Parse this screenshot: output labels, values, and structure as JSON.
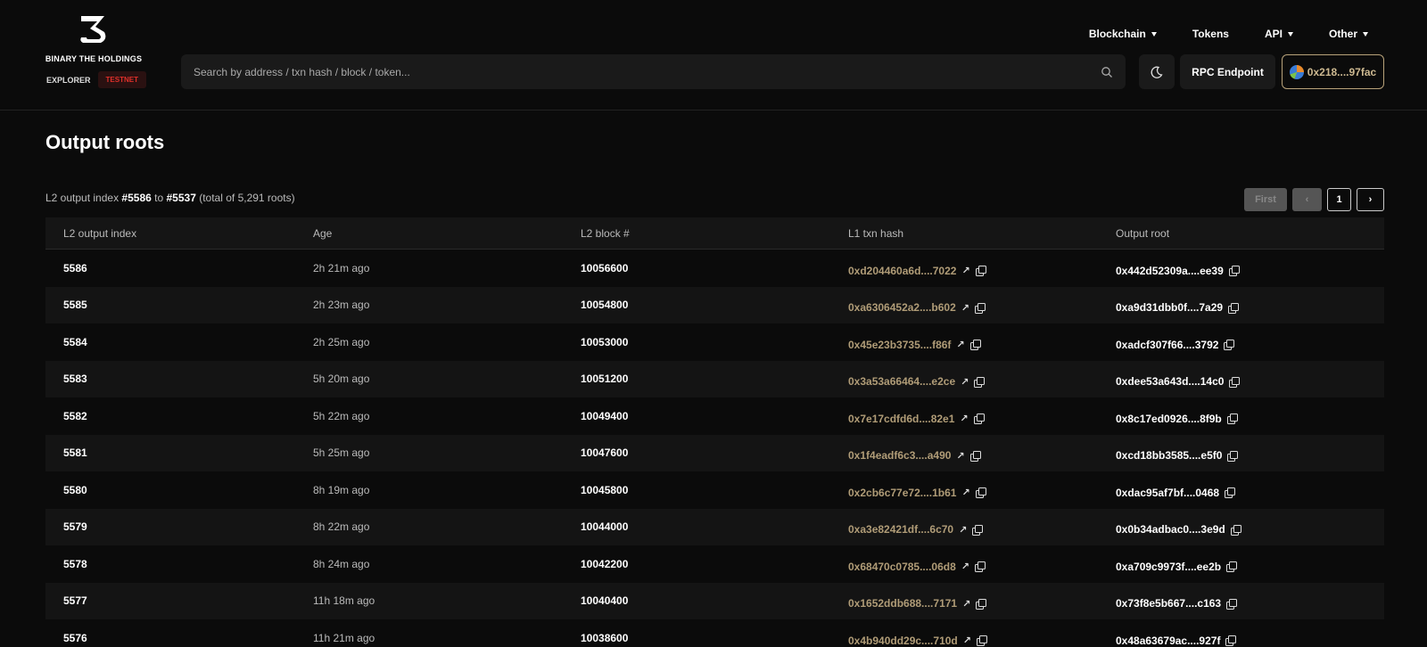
{
  "brand": {
    "name": "BINARY THE HOLDINGS",
    "explorer": "EXPLORER",
    "network": "TESTNET"
  },
  "search": {
    "placeholder": "Search by address / txn hash / block / token..."
  },
  "nav": {
    "items": [
      {
        "label": "Blockchain",
        "dropdown": true
      },
      {
        "label": "Tokens",
        "dropdown": false
      },
      {
        "label": "API",
        "dropdown": true
      },
      {
        "label": "Other",
        "dropdown": true
      }
    ]
  },
  "actions": {
    "rpc": "RPC Endpoint",
    "wallet": "0x218....97fac"
  },
  "page": {
    "title": "Output roots"
  },
  "range": {
    "prefix": "L2 output index",
    "from": "#5586",
    "to_word": "to",
    "to": "#5537",
    "total": "(total of 5,291 roots)"
  },
  "pager": {
    "first": "First",
    "prev": "‹",
    "current": "1",
    "next": "›"
  },
  "table": {
    "headers": [
      "L2 output index",
      "Age",
      "L2 block #",
      "L1 txn hash",
      "Output root"
    ],
    "rows": [
      [
        "5586",
        "2h 21m ago",
        "10056600",
        "0xd204460a6d....7022",
        "0x442d52309a....ee39"
      ],
      [
        "5585",
        "2h 23m ago",
        "10054800",
        "0xa6306452a2....b602",
        "0xa9d31dbb0f....7a29"
      ],
      [
        "5584",
        "2h 25m ago",
        "10053000",
        "0x45e23b3735....f86f",
        "0xadcf307f66....3792"
      ],
      [
        "5583",
        "5h 20m ago",
        "10051200",
        "0x3a53a66464....e2ce",
        "0xdee53a643d....14c0"
      ],
      [
        "5582",
        "5h 22m ago",
        "10049400",
        "0x7e17cdfd6d....82e1",
        "0x8c17ed0926....8f9b"
      ],
      [
        "5581",
        "5h 25m ago",
        "10047600",
        "0x1f4eadf6c3....a490",
        "0xcd18bb3585....e5f0"
      ],
      [
        "5580",
        "8h 19m ago",
        "10045800",
        "0x2cb6c77e72....1b61",
        "0xdac95af7bf....0468"
      ],
      [
        "5579",
        "8h 22m ago",
        "10044000",
        "0xa3e82421df....6c70",
        "0x0b34adbac0....3e9d"
      ],
      [
        "5578",
        "8h 24m ago",
        "10042200",
        "0x68470c0785....06d8",
        "0xa709c9973f....ee2b"
      ],
      [
        "5577",
        "11h 18m ago",
        "10040400",
        "0x1652ddb688....7171",
        "0x73f8e5b667....c163"
      ],
      [
        "5576",
        "11h 21m ago",
        "10038600",
        "0x4b940dd29c....710d",
        "0x48a63679ac....927f"
      ]
    ]
  },
  "colors": {
    "accent": "#b09c77",
    "testnet": "#e0302a",
    "background": "#0b0b0b"
  }
}
